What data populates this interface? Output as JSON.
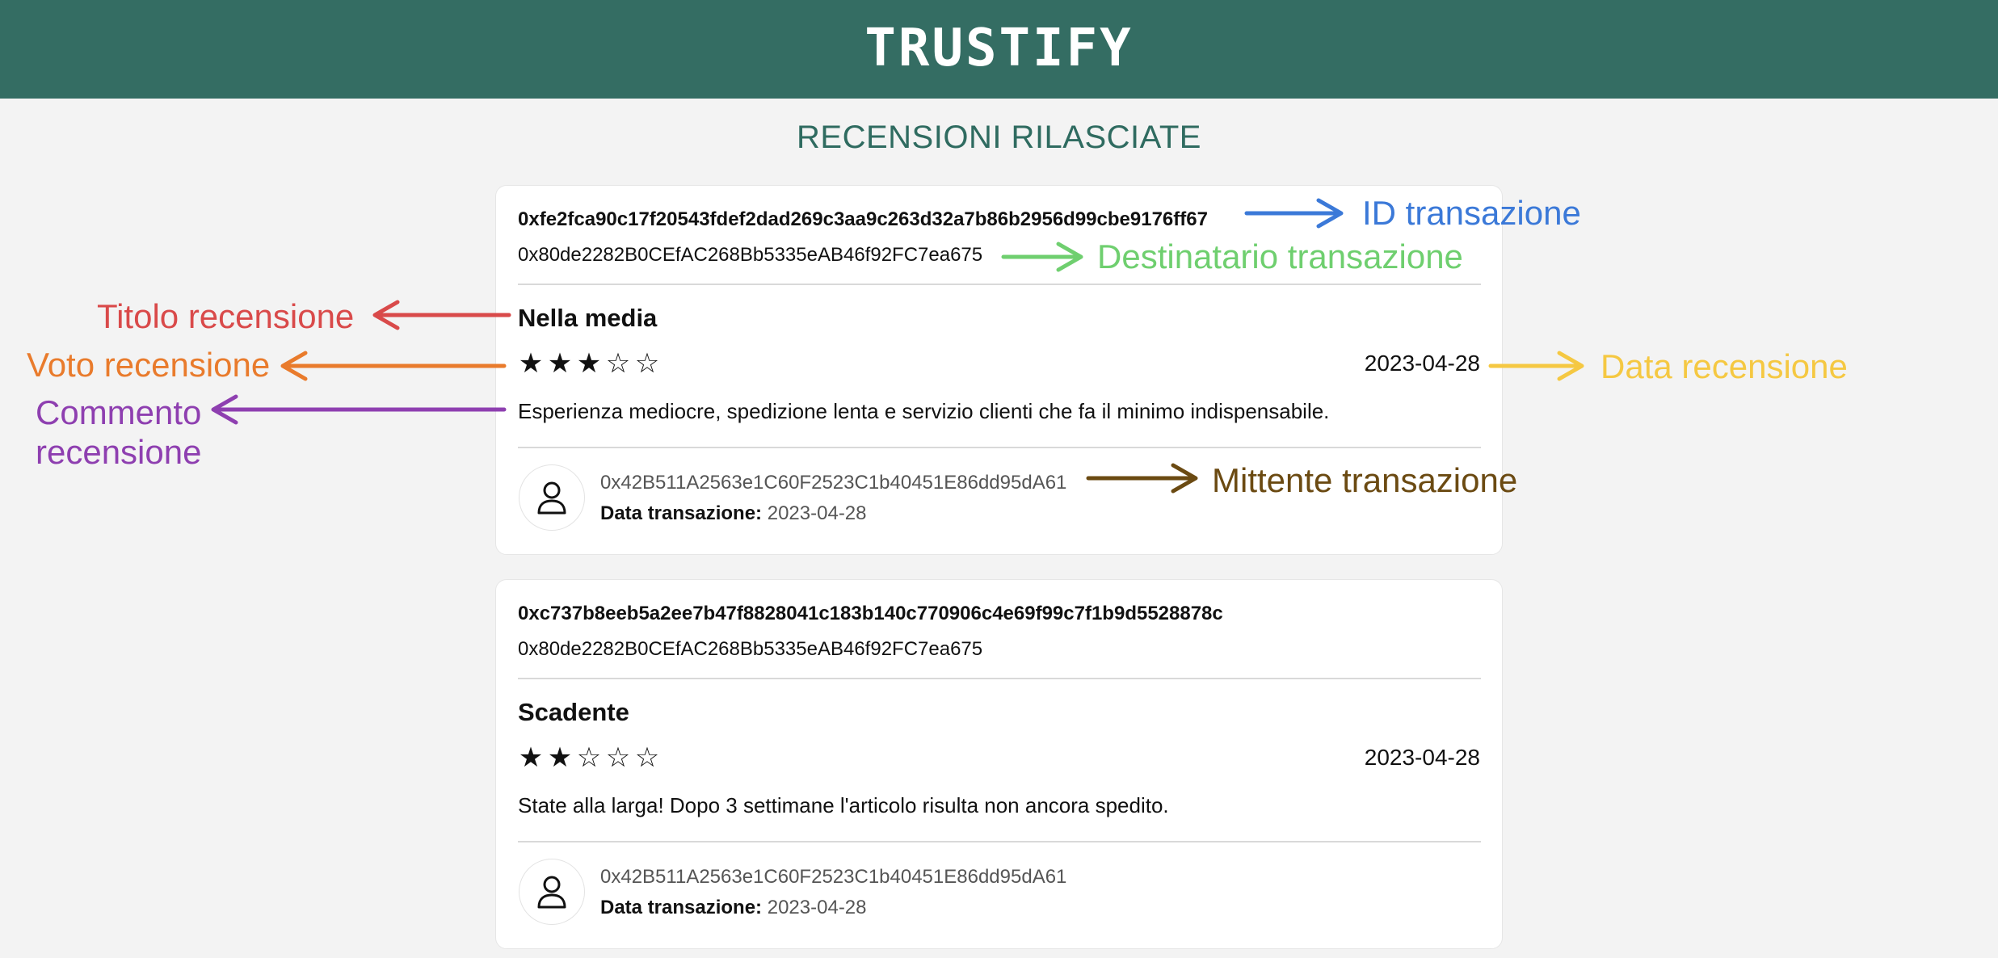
{
  "header": {
    "brand": "TRUSTIFY"
  },
  "page": {
    "title": "RECENSIONI RILASCIATE"
  },
  "reviews": [
    {
      "tx_id": "0xfe2fca90c17f20543fdef2dad269c3aa9c263d32a7b86b2956d99cbe9176ff67",
      "recipient": "0x80de2282B0CEfAC268Bb5335eAB46f92FC7ea675",
      "title": "Nella media",
      "rating": 3,
      "rating_max": 5,
      "date": "2023-04-28",
      "comment": "Esperienza mediocre, spedizione lenta e servizio clienti che fa il minimo indispensabile.",
      "sender": "0x42B511A2563e1C60F2523C1b40451E86dd95dA61",
      "tx_date_label": "Data transazione:",
      "tx_date": "2023-04-28"
    },
    {
      "tx_id": "0xc737b8eeb5a2ee7b47f8828041c183b140c770906c4e69f99c7f1b9d5528878c",
      "recipient": "0x80de2282B0CEfAC268Bb5335eAB46f92FC7ea675",
      "title": "Scadente",
      "rating": 2,
      "rating_max": 5,
      "date": "2023-04-28",
      "comment": "State alla larga! Dopo 3 settimane l'articolo risulta non ancora spedito.",
      "sender": "0x42B511A2563e1C60F2523C1b40451E86dd95dA61",
      "tx_date_label": "Data transazione:",
      "tx_date": "2023-04-28"
    }
  ],
  "annotations": {
    "id_transazione": {
      "text": "ID transazione",
      "color": "#3b79d8"
    },
    "destinatario": {
      "text": "Destinatario transazione",
      "color": "#6fcf6f"
    },
    "titolo": {
      "text": "Titolo recensione",
      "color": "#d94a4a"
    },
    "voto": {
      "text": "Voto recensione",
      "color": "#e97b2c"
    },
    "commento_1": {
      "text": "Commento",
      "color": "#8e3fb0"
    },
    "commento_2": {
      "text": "recensione",
      "color": "#8e3fb0"
    },
    "data_recensione": {
      "text": "Data recensione",
      "color": "#f5c842"
    },
    "mittente": {
      "text": "Mittente transazione",
      "color": "#6b4a12"
    }
  }
}
